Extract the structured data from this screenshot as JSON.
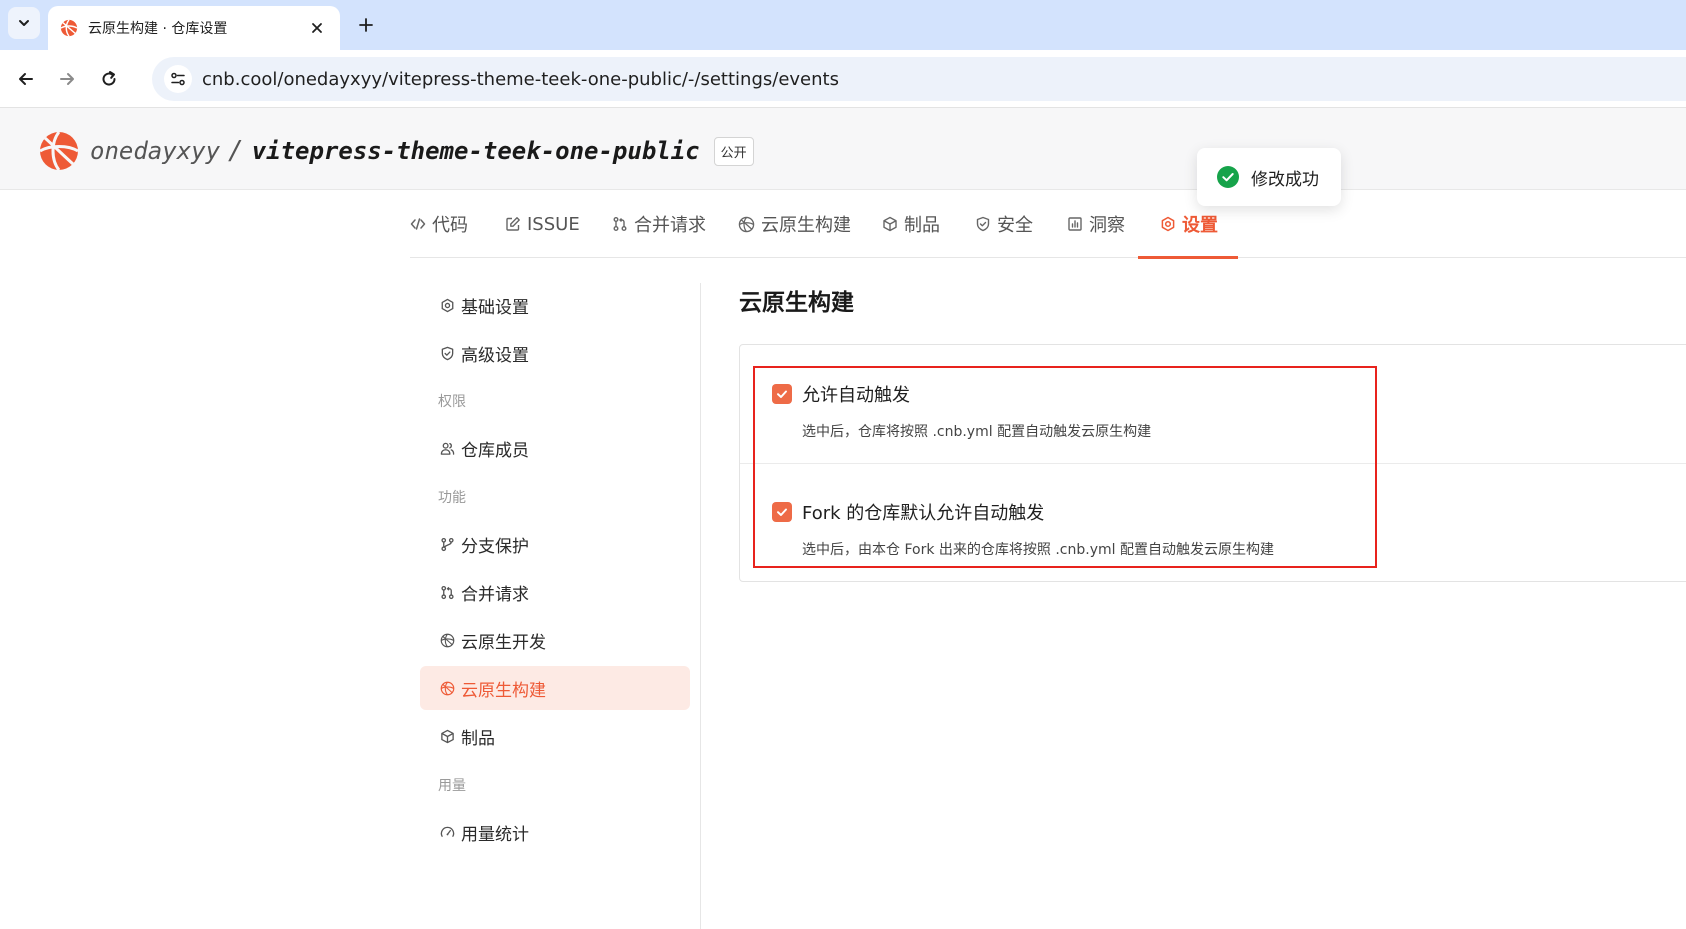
{
  "browser": {
    "tab_title": "云原生构建 · 仓库设置",
    "url": "cnb.cool/onedayxyy/vitepress-theme-teek-one-public/-/settings/events"
  },
  "repo": {
    "owner": "onedayxyy",
    "separator": "/",
    "name": "vitepress-theme-teek-one-public",
    "visibility": "公开"
  },
  "repo_tabs": [
    {
      "label": "代码",
      "icon": "code-icon"
    },
    {
      "label": "ISSUE",
      "icon": "edit-icon"
    },
    {
      "label": "合并请求",
      "icon": "pull-request-icon"
    },
    {
      "label": "云原生构建",
      "icon": "build-icon"
    },
    {
      "label": "制品",
      "icon": "package-icon"
    },
    {
      "label": "安全",
      "icon": "shield-icon"
    },
    {
      "label": "洞察",
      "icon": "chart-icon"
    },
    {
      "label": "设置",
      "icon": "gear-icon",
      "active": true
    }
  ],
  "toast": {
    "message": "修改成功"
  },
  "sidenav": {
    "items_top": [
      {
        "label": "基础设置",
        "icon": "gear-icon"
      },
      {
        "label": "高级设置",
        "icon": "shield-icon"
      }
    ],
    "group_permissions": "权限",
    "items_permissions": [
      {
        "label": "仓库成员",
        "icon": "users-icon"
      }
    ],
    "group_features": "功能",
    "items_features": [
      {
        "label": "分支保护",
        "icon": "branch-icon"
      },
      {
        "label": "合并请求",
        "icon": "pull-request-icon"
      },
      {
        "label": "云原生开发",
        "icon": "build-icon"
      },
      {
        "label": "云原生构建",
        "icon": "build-icon",
        "active": true
      },
      {
        "label": "制品",
        "icon": "package-icon"
      }
    ],
    "group_usage": "用量",
    "items_usage": [
      {
        "label": "用量统计",
        "icon": "gauge-icon"
      }
    ]
  },
  "main": {
    "title": "云原生构建",
    "options": [
      {
        "label": "允许自动触发",
        "checked": true,
        "description": "选中后，仓库将按照 .cnb.yml 配置自动触发云原生构建"
      },
      {
        "label": "Fork 的仓库默认允许自动触发",
        "checked": true,
        "description": "选中后，由本仓 Fork 出来的仓库将按照 .cnb.yml 配置自动触发云原生构建"
      }
    ]
  },
  "colors": {
    "accent": "#ee5a36",
    "success": "#16a34a",
    "highlight": "#e8231d"
  }
}
